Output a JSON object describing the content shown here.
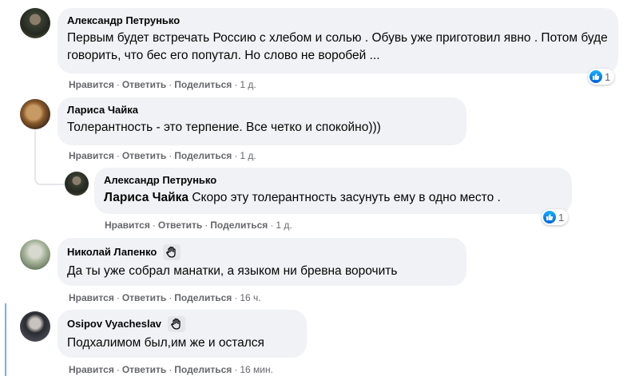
{
  "actions": {
    "like": "Нравится",
    "reply": "Ответить",
    "share": "Поделиться",
    "sep": "·"
  },
  "comments": [
    {
      "author": "Александр Петрунько",
      "text": "Первым будет встречать Россию с хлебом и солью . Обувь уже приготовил явно . Потом буде говорить, что бес его попутал. Но слово не воробей ...",
      "time": "1 д.",
      "reactions": "1"
    },
    {
      "author": "Лариса Чайка",
      "text": "Толерантность - это терпение. Все четко и спокойно)))",
      "time": "1 д."
    },
    {
      "author": "Александр Петрунько",
      "mention": "Лариса Чайка",
      "text": " Скоро эту толерантность засунуть ему в одно место .",
      "time": "1 д.",
      "reactions": "1"
    },
    {
      "author": "Николай Лапенко",
      "text": "Да ты уже собрал манатки, а языком ни бревна ворочить",
      "time": "16 ч.",
      "badge": "wave-icon"
    },
    {
      "author": "Osipov Vyacheslav",
      "text": "Подхалимом был,им же и остался",
      "time": "16 мин.",
      "badge": "wave-icon"
    }
  ],
  "colors": {
    "bubble": "#f0f2f5",
    "meta": "#65676b",
    "text": "#050505",
    "like": "#1877f2"
  }
}
